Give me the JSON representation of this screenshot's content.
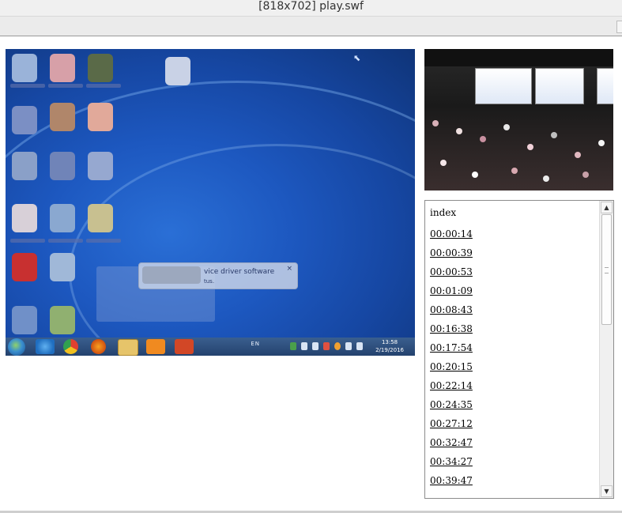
{
  "window": {
    "title": "[818x702] play.swf"
  },
  "screen_capture": {
    "balloon": {
      "title": "vice driver software",
      "subtitle": "tus.",
      "close_glyph": "×"
    },
    "taskbar": {
      "tray_text": "EN",
      "clock_time": "13:58",
      "clock_date": "2/19/2016"
    },
    "cursor_glyph": "⬉"
  },
  "index": {
    "title": "index",
    "items": [
      "00:00:14",
      "00:00:39",
      "00:00:53",
      "00:01:09",
      "00:08:43",
      "00:16:38",
      "00:17:54",
      "00:20:15",
      "00:22:14",
      "00:24:35",
      "00:27:12",
      "00:32:47",
      "00:34:27",
      "00:39:47"
    ],
    "scroll_up_glyph": "▲",
    "scroll_down_glyph": "▼"
  },
  "colors": {
    "desktop_blue": "#1d58c0",
    "taskbar": "#2a4a78",
    "link": "#000000"
  },
  "icons": [
    "start-orb-icon",
    "ie-icon",
    "chrome-icon",
    "firefox-icon",
    "folder-icon",
    "media-player-icon",
    "powerpoint-icon",
    "close-icon",
    "scroll-up-icon",
    "scroll-down-icon"
  ]
}
